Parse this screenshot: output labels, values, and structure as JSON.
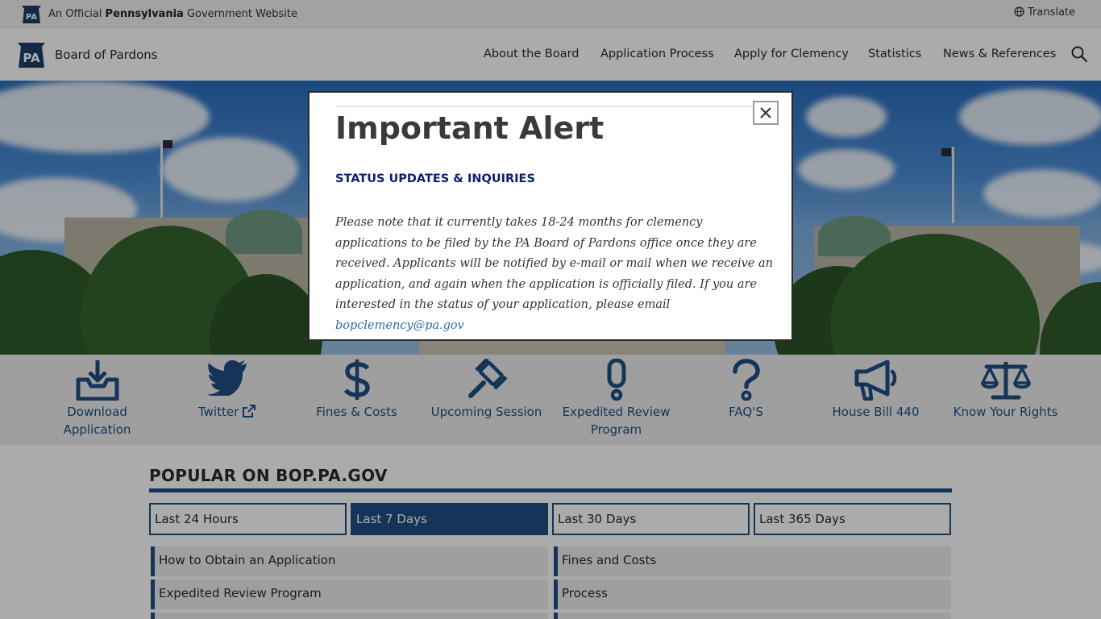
{
  "gov_banner": {
    "official_prefix": "An Official ",
    "official_state": "Pennsylvania",
    "official_suffix": " Government Website",
    "translate_label": "Translate",
    "keystone_label": "PA"
  },
  "header": {
    "logo_label": "PA",
    "site_name": "Board of Pardons",
    "nav": [
      "About the Board",
      "Application Process",
      "Apply for Clemency",
      "Statistics",
      "News & References"
    ]
  },
  "quick_links": [
    {
      "label": "Download Application",
      "icon": "download-tray-icon"
    },
    {
      "label": "Twitter",
      "icon": "twitter-bird-icon"
    },
    {
      "label": "Fines & Costs",
      "icon": "dollar-icon"
    },
    {
      "label": "Upcoming Session",
      "icon": "gavel-icon"
    },
    {
      "label": "Expedited Review Program",
      "icon": "exclamation-icon"
    },
    {
      "label": "FAQ'S",
      "icon": "question-icon"
    },
    {
      "label": "House Bill 440",
      "icon": "megaphone-icon"
    },
    {
      "label": "Know Your Rights",
      "icon": "scales-icon"
    }
  ],
  "popular": {
    "title": "POPULAR ON BOP.PA.GOV",
    "tabs": [
      "Last 24 Hours",
      "Last 7 Days",
      "Last 30 Days",
      "Last 365 Days"
    ],
    "active_tab": "Last 7 Days",
    "items": [
      "How to Obtain an Application",
      "Fines and Costs",
      "Expedited Review Program",
      "Process"
    ]
  },
  "modal": {
    "title": "Important Alert",
    "subtitle": "STATUS UPDATES & INQUIRIES",
    "body": "Please note that it currently takes 18-24 months for clemency applications to be filed by the PA Board of Pardons office once they are received.  Applicants will be notified by e-mail or mail when we receive an application, and again when the application is officially filed.  If you are interested in the status of your application, please email ",
    "email": "bopclemency@pa.gov"
  },
  "colors": {
    "brand_blue": "#1f4f82",
    "alert_navy": "#0b1f72",
    "link": "#2b6ca5"
  }
}
